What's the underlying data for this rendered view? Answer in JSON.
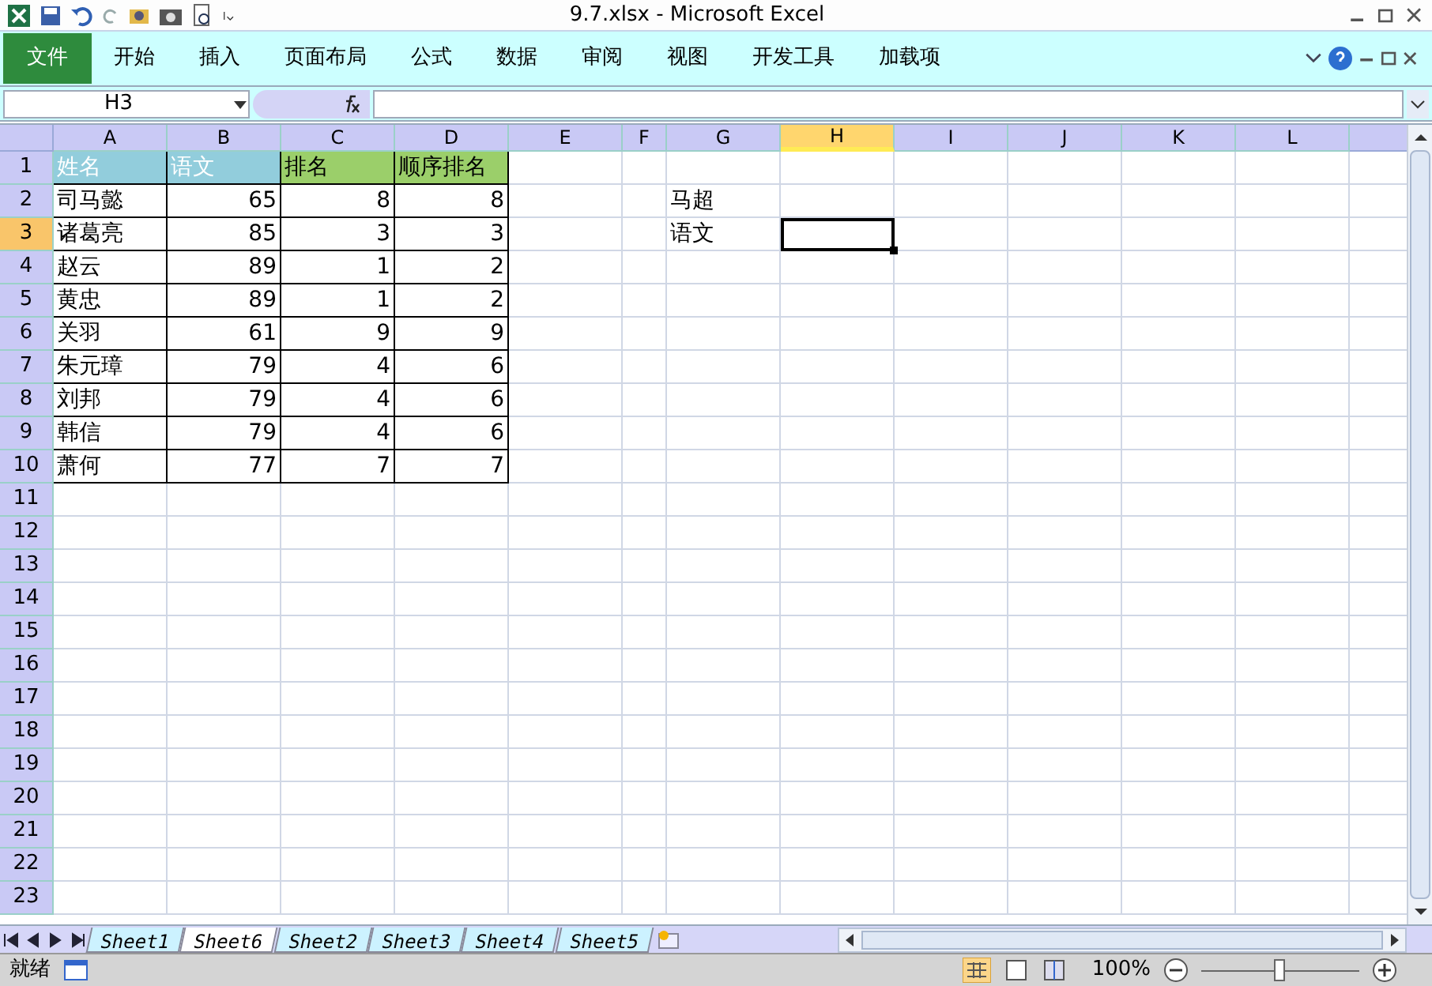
{
  "window": {
    "title": "9.7.xlsx  -  Microsoft Excel"
  },
  "ribbon_tabs": [
    {
      "label": "文件",
      "kind": "file",
      "selected": false
    },
    {
      "label": "开始",
      "kind": "tab",
      "selected": false
    },
    {
      "label": "插入",
      "kind": "tab",
      "selected": false
    },
    {
      "label": "页面布局",
      "kind": "tab",
      "selected": false
    },
    {
      "label": "公式",
      "kind": "tab",
      "selected": false
    },
    {
      "label": "数据",
      "kind": "tab",
      "selected": false
    },
    {
      "label": "审阅",
      "kind": "tab",
      "selected": false
    },
    {
      "label": "视图",
      "kind": "tab",
      "selected": false
    },
    {
      "label": "开发工具",
      "kind": "tab",
      "selected": false
    },
    {
      "label": "加载项",
      "kind": "tab",
      "selected": false
    }
  ],
  "name_box": "H3",
  "sheet": {
    "columns": [
      {
        "label": "A",
        "selected": false
      },
      {
        "label": "B",
        "selected": false
      },
      {
        "label": "C",
        "selected": false
      },
      {
        "label": "D",
        "selected": false
      },
      {
        "label": "E",
        "selected": false
      },
      {
        "label": "F",
        "selected": false
      },
      {
        "label": "G",
        "selected": false
      },
      {
        "label": "H",
        "selected": true
      },
      {
        "label": "I",
        "selected": false
      },
      {
        "label": "J",
        "selected": false
      },
      {
        "label": "K",
        "selected": false
      },
      {
        "label": "L",
        "selected": false
      }
    ],
    "rows": [
      {
        "label": "1",
        "selected": false
      },
      {
        "label": "2",
        "selected": false
      },
      {
        "label": "3",
        "selected": true
      },
      {
        "label": "4",
        "selected": false
      },
      {
        "label": "5",
        "selected": false
      },
      {
        "label": "6",
        "selected": false
      },
      {
        "label": "7",
        "selected": false
      },
      {
        "label": "8",
        "selected": false
      },
      {
        "label": "9",
        "selected": false
      },
      {
        "label": "10",
        "selected": false
      },
      {
        "label": "11",
        "selected": false
      },
      {
        "label": "12",
        "selected": false
      },
      {
        "label": "13",
        "selected": false
      },
      {
        "label": "14",
        "selected": false
      },
      {
        "label": "15",
        "selected": false
      },
      {
        "label": "16",
        "selected": false
      },
      {
        "label": "17",
        "selected": false
      },
      {
        "label": "18",
        "selected": false
      },
      {
        "label": "19",
        "selected": false
      },
      {
        "label": "20",
        "selected": false
      },
      {
        "label": "21",
        "selected": false
      },
      {
        "label": "22",
        "selected": false
      },
      {
        "label": "23",
        "selected": false
      }
    ],
    "table": {
      "headers": [
        {
          "label": "姓名",
          "color": "#92cddc"
        },
        {
          "label": "语文",
          "color": "#92cddc"
        },
        {
          "label": "排名",
          "color": "#9bcf6a"
        },
        {
          "label": "顺序排名",
          "color": "#9bcf6a"
        }
      ],
      "rows": [
        [
          "司马懿",
          "65",
          "8",
          "8"
        ],
        [
          "诸葛亮",
          "85",
          "3",
          "3"
        ],
        [
          "赵云",
          "89",
          "1",
          "2"
        ],
        [
          "黄忠",
          "89",
          "1",
          "2"
        ],
        [
          "关羽",
          "61",
          "9",
          "9"
        ],
        [
          "朱元璋",
          "79",
          "4",
          "6"
        ],
        [
          "刘邦",
          "79",
          "4",
          "6"
        ],
        [
          "韩信",
          "79",
          "4",
          "6"
        ],
        [
          "萧何",
          "77",
          "7",
          "7"
        ]
      ]
    },
    "column_g": [
      "马超",
      "语文"
    ]
  },
  "sheet_tabs": [
    {
      "label": "Sheet1",
      "selected": false
    },
    {
      "label": "Sheet6",
      "selected": true
    },
    {
      "label": "Sheet2",
      "selected": false
    },
    {
      "label": "Sheet3",
      "selected": false
    },
    {
      "label": "Sheet4",
      "selected": false
    },
    {
      "label": "Sheet5",
      "selected": false
    }
  ],
  "status_bar": {
    "status": "就绪",
    "zoom": "100%",
    "zoom_slider": {
      "level": 0.5
    }
  }
}
